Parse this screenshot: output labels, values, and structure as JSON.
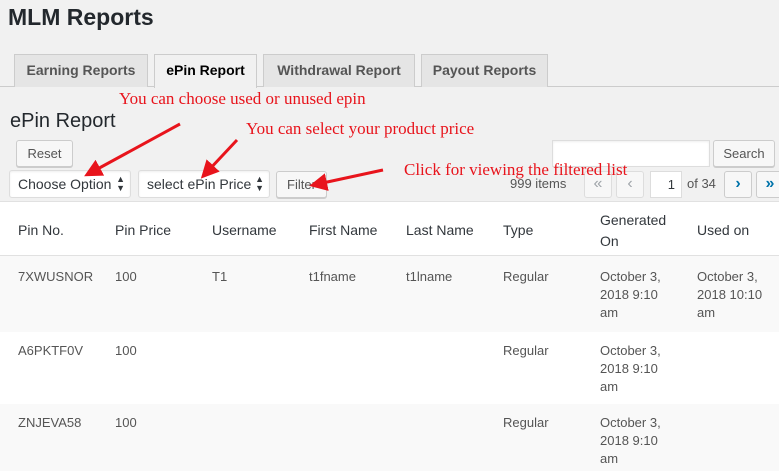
{
  "page": {
    "title": "MLM Reports"
  },
  "tabs": [
    {
      "label": "Earning Reports",
      "active": false
    },
    {
      "label": "ePin Report",
      "active": true
    },
    {
      "label": "Withdrawal Report",
      "active": false
    },
    {
      "label": "Payout Reports",
      "active": false
    }
  ],
  "section": {
    "title": "ePin Report"
  },
  "controls": {
    "reset_label": "Reset",
    "search_value": "",
    "search_button_label": "Search",
    "status_select_value": "Choose Option",
    "price_select_value": "select ePin Price",
    "filter_label": "Filter"
  },
  "pagination": {
    "items_count": "999 items",
    "first_icon": "«",
    "prev_icon": "‹",
    "current_page": "1",
    "of_text": "of 34",
    "next_icon": "›",
    "last_icon": "»"
  },
  "table": {
    "headers": [
      "Pin No.",
      "Pin Price",
      "Username",
      "First Name",
      "Last Name",
      "Type",
      "Generated On",
      "Used on"
    ],
    "generated_on_lines": [
      "Generated",
      "On"
    ],
    "rows": [
      {
        "pin": "7XWUSNOR",
        "price": "100",
        "username": "T1",
        "first": "t1fname",
        "last": "t1lname",
        "type": "Regular",
        "generated": [
          "October 3,",
          "2018 9:10",
          "am"
        ],
        "used": [
          "October 3,",
          "2018 10:10",
          "am"
        ]
      },
      {
        "pin": "A6PKTF0V",
        "price": "100",
        "username": "",
        "first": "",
        "last": "",
        "type": "Regular",
        "generated": [
          "October 3,",
          "2018 9:10",
          "am"
        ],
        "used": [
          "",
          "",
          ""
        ]
      },
      {
        "pin": "ZNJEVA58",
        "price": "100",
        "username": "",
        "first": "",
        "last": "",
        "type": "Regular",
        "generated": [
          "October 3,",
          "2018 9:10",
          "am"
        ],
        "used": [
          "",
          "",
          ""
        ]
      }
    ]
  },
  "annotations": {
    "used_unused": "You can choose used or unused epin",
    "product_price": "You can select your product price",
    "filtered_list": "Click for viewing the filtered list",
    "color": "#e8141c"
  }
}
